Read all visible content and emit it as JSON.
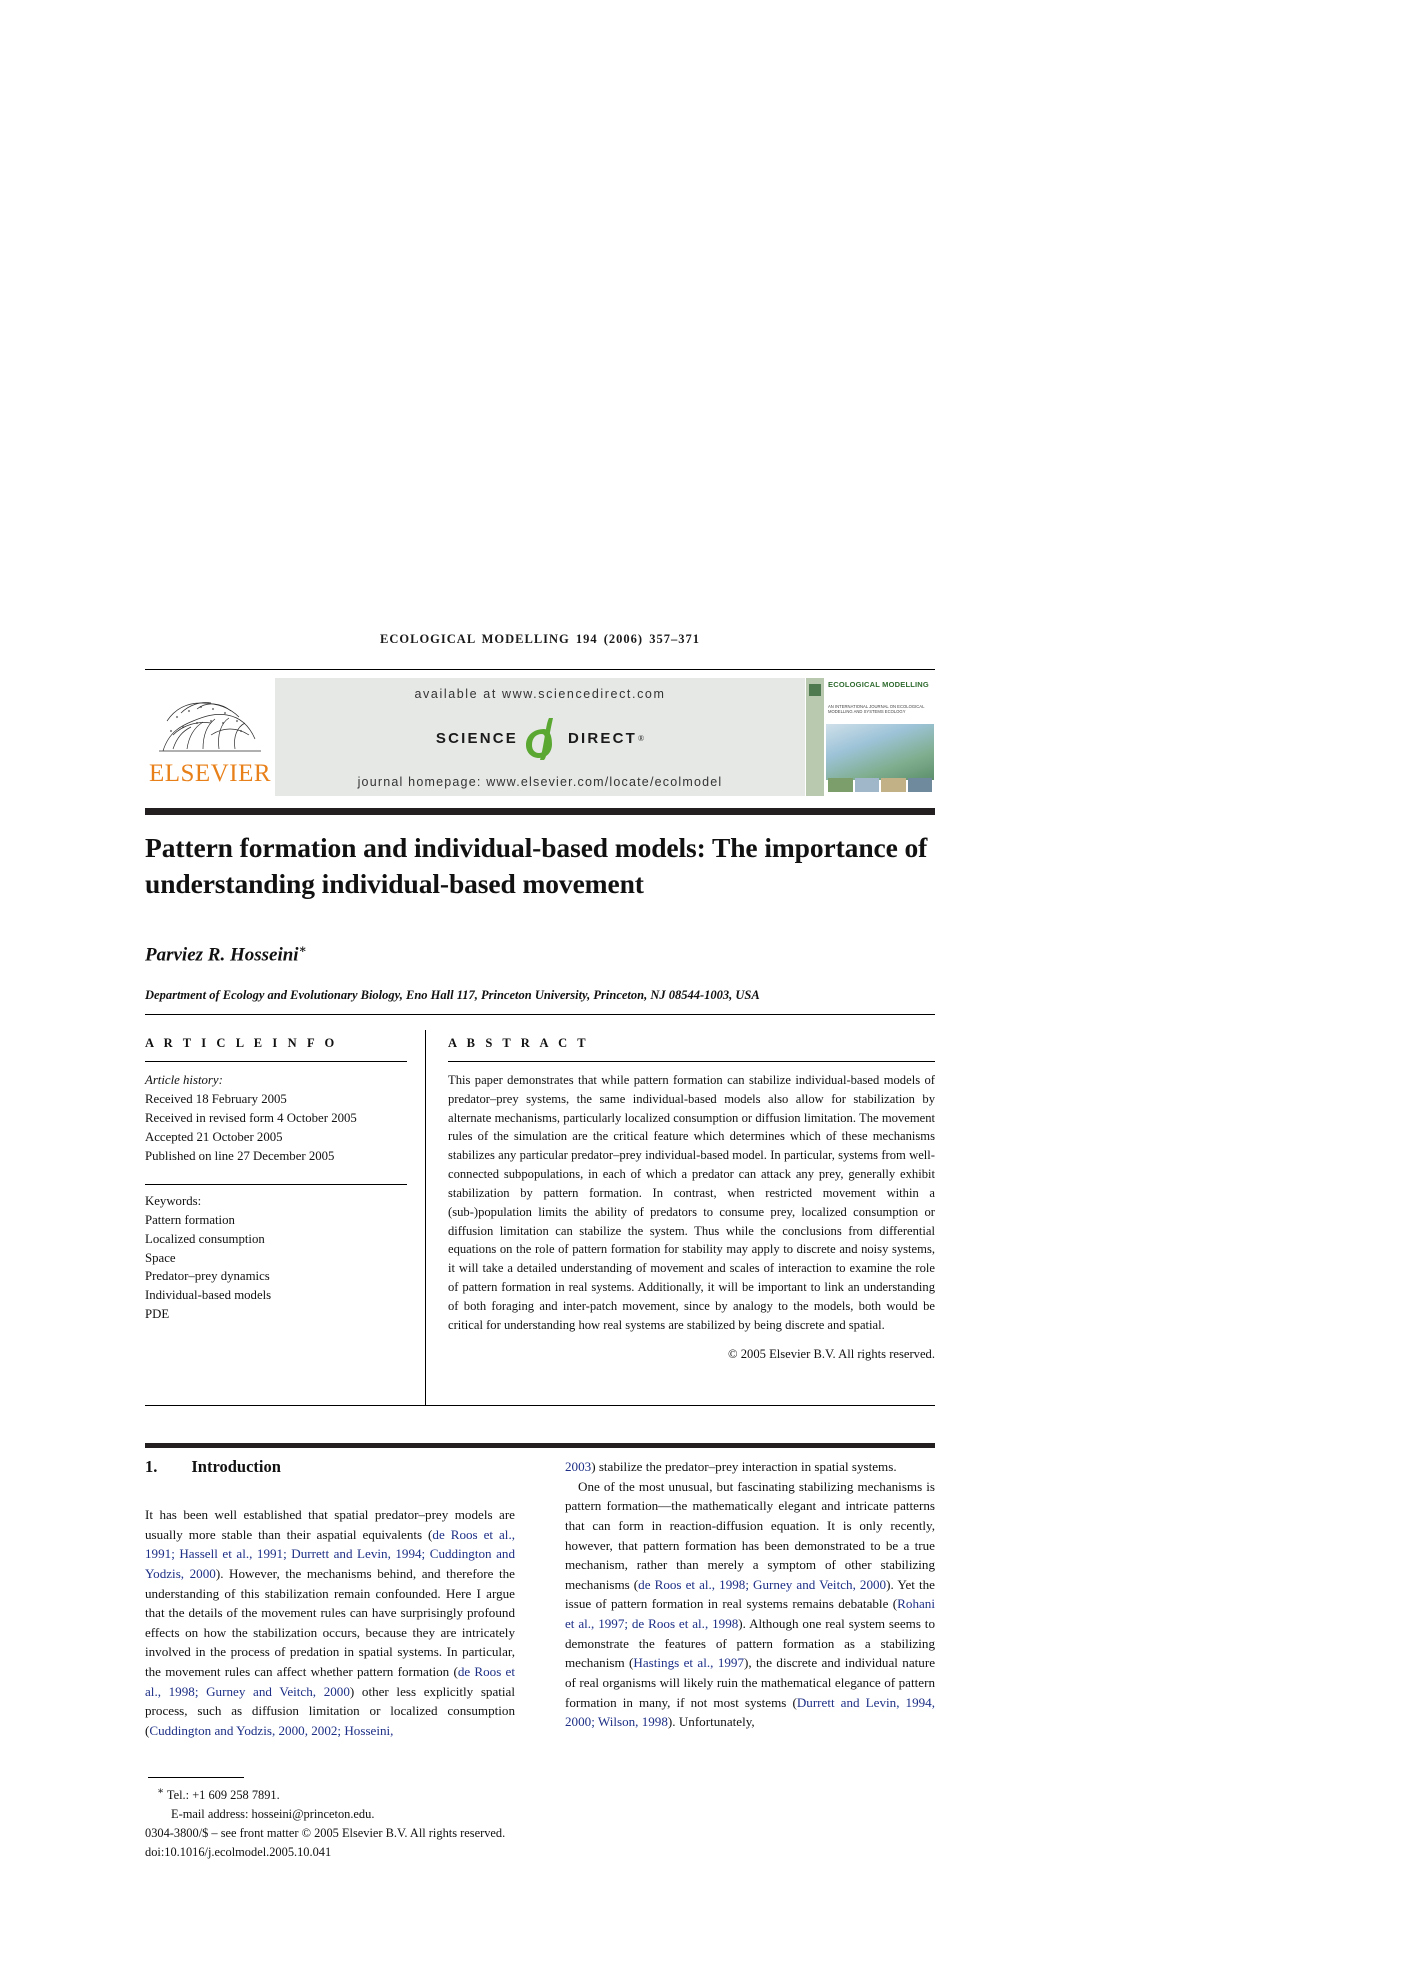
{
  "running_head": "ECOLOGICAL MODELLING  194 (2006) 357–371",
  "banner": {
    "available_at": "available at www.sciencedirect.com",
    "science_word": "SCIENCE",
    "direct_word": "DIRECT",
    "registered_mark": "®",
    "journal_homepage": "journal homepage: www.elsevier.com/locate/ecolmodel",
    "publisher": "ELSEVIER",
    "cover_title": "ECOLOGICAL MODELLING",
    "cover_subtitle": "AN INTERNATIONAL JOURNAL ON ECOLOGICAL MODELLING AND SYSTEMS ECOLOGY"
  },
  "title": "Pattern formation and individual-based models: The importance of understanding individual-based movement",
  "author": "Parviez R. Hosseini",
  "author_marker": "∗",
  "affiliation": "Department of Ecology and Evolutionary Biology, Eno Hall 117, Princeton University, Princeton, NJ 08544-1003, USA",
  "article_info": {
    "heading": "A R T I C L E   I N F O",
    "history_label": "Article history:",
    "history": [
      "Received 18 February 2005",
      "Received in revised form 4 October 2005",
      "Accepted 21 October 2005",
      "Published on line 27 December 2005"
    ],
    "keywords_label": "Keywords:",
    "keywords": [
      "Pattern formation",
      "Localized consumption",
      "Space",
      "Predator–prey dynamics",
      "Individual-based models",
      "PDE"
    ]
  },
  "abstract": {
    "heading": "A B S T R A C T",
    "text": "This paper demonstrates that while pattern formation can stabilize individual-based models of predator–prey systems, the same individual-based models also allow for stabilization by alternate mechanisms, particularly localized consumption or diffusion limitation. The movement rules of the simulation are the critical feature which determines which of these mechanisms stabilizes any particular predator–prey individual-based model. In particular, systems from well-connected subpopulations, in each of which a predator can attack any prey, generally exhibit stabilization by pattern formation. In contrast, when restricted movement within a (sub-)population limits the ability of predators to consume prey, localized consumption or diffusion limitation can stabilize the system. Thus while the conclusions from differential equations on the role of pattern formation for stability may apply to discrete and noisy systems, it will take a detailed understanding of movement and scales of interaction to examine the role of pattern formation in real systems. Additionally, it will be important to link an understanding of both foraging and inter-patch movement, since by analogy to the models, both would be critical for understanding how real systems are stabilized by being discrete and spatial.",
    "copyright": "© 2005 Elsevier B.V. All rights reserved."
  },
  "introduction": {
    "number": "1.",
    "title": "Introduction",
    "left_paragraph_1_a": "It has been well established that spatial predator–prey models are usually more stable than their aspatial equivalents (",
    "left_cite_1": "de Roos et al., 1991; Hassell et al., 1991; Durrett and Levin, 1994; Cuddington and Yodzis, 2000",
    "left_paragraph_1_b": "). However, the mechanisms behind, and therefore the understanding of this stabilization remain confounded. Here I argue that the details of the movement rules can have surprisingly profound effects on how the stabilization occurs, because they are intricately involved in the process of predation in spatial systems. In particular, the movement rules can affect whether pattern formation (",
    "left_cite_2": "de Roos et al., 1998; Gurney and Veitch, 2000",
    "left_paragraph_1_c": ") other less explicitly spatial process, such as diffusion limitation or localized consumption (",
    "left_cite_3": "Cuddington and Yodzis, 2000, 2002; Hosseini,",
    "right_cite_0": "2003",
    "right_paragraph_1_d": ") stabilize the predator–prey interaction in spatial systems.",
    "right_paragraph_2_a": "One of the most unusual, but fascinating stabilizing mechanisms is pattern formation—the mathematically elegant and intricate patterns that can form in reaction-diffusion equation. It is only recently, however, that pattern formation has been demonstrated to be a true mechanism, rather than merely a symptom of other stabilizing mechanisms (",
    "right_cite_1": "de Roos et al., 1998; Gurney and Veitch, 2000",
    "right_paragraph_2_b": "). Yet the issue of pattern formation in real systems remains debatable (",
    "right_cite_2": "Rohani et al., 1997; de Roos et al., 1998",
    "right_paragraph_2_c": "). Although one real system seems to demonstrate the features of pattern formation as a stabilizing mechanism (",
    "right_cite_3": "Hastings et al., 1997",
    "right_paragraph_2_d": "), the discrete and individual nature of real organisms will likely ruin the mathematical elegance of pattern formation in many, if not most systems (",
    "right_cite_4": "Durrett and Levin, 1994, 2000; Wilson, 1998",
    "right_paragraph_2_e": "). Unfortunately,"
  },
  "footnotes": {
    "tel_marker": "∗",
    "tel": "Tel.: +1 609 258 7891.",
    "email": "E-mail address: hosseini@princeton.edu.",
    "issn_line": "0304-3800/$ – see front matter © 2005 Elsevier B.V. All rights reserved.",
    "doi": "doi:10.1016/j.ecolmodel.2005.10.041"
  },
  "colors": {
    "citation_link": "#1d2f86",
    "elsevier_orange": "#E8801A",
    "sciencedirect_green": "#5aa832",
    "banner_gray": "#e6e8e6",
    "rule_black": "#231f20"
  }
}
